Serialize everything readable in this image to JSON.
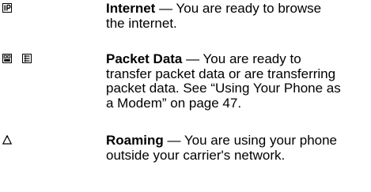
{
  "entries": [
    {
      "icons": [
        "internet-ip-icon"
      ],
      "term": "Internet",
      "separator": " — ",
      "description": "You are ready to browse the internet."
    },
    {
      "icons": [
        "packet-data-icon",
        "packet-transfer-icon"
      ],
      "term": "Packet Data",
      "separator": " — ",
      "description": "You are ready to transfer packet data or are transferring packet data. See “Using Your Phone as a Modem” on page 47."
    },
    {
      "icons": [
        "roaming-icon"
      ],
      "term": "Roaming",
      "separator": " — ",
      "description": "You are using your phone outside your carrier's network."
    }
  ]
}
